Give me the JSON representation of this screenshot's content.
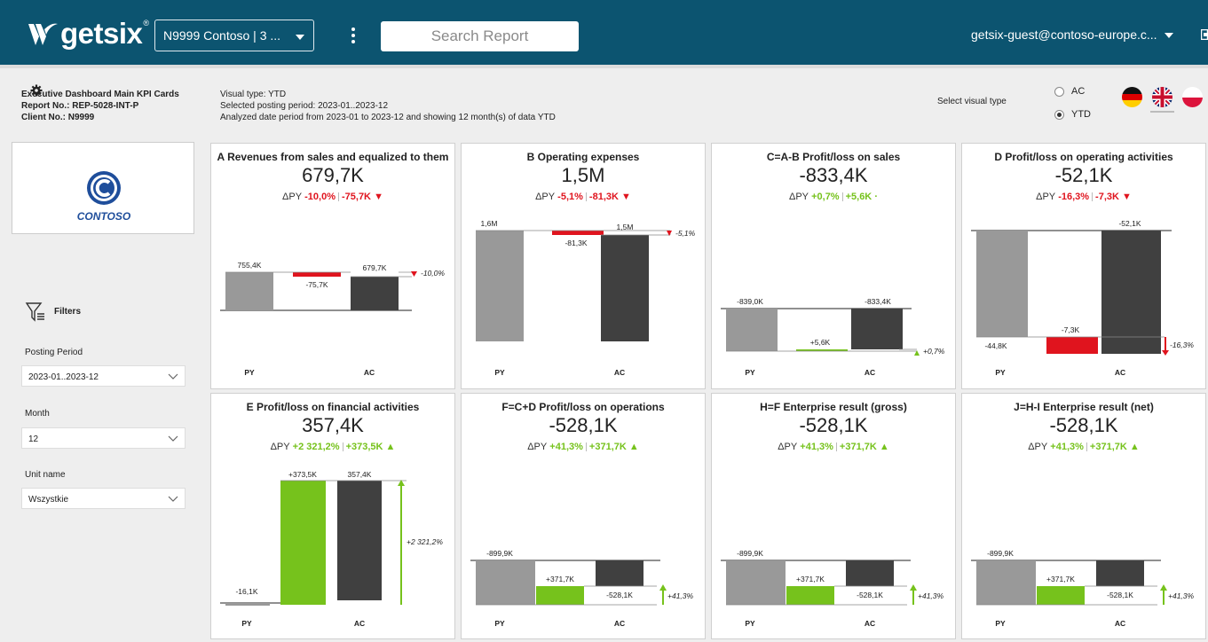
{
  "header": {
    "logo_text": "getsix",
    "logo_mark": "®",
    "client_select": "N9999 Contoso | 3 ...",
    "search_placeholder": "Search Report",
    "user": "getsix-guest@contoso-europe.c..."
  },
  "report": {
    "title": "Executive Dashboard Main KPI Cards",
    "report_no": "Report No.: REP-5028-INT-P",
    "client_no": "Client No.: N9999",
    "visual_type": "Visual type: YTD",
    "posting_period": "Selected posting period: 2023-01..2023-12",
    "analyzed": "Analyzed date period from 2023-01 to 2023-12 and showing 12 month(s) of data YTD"
  },
  "visual_select": {
    "label": "Select visual type",
    "options": [
      {
        "label": "AC",
        "selected": false
      },
      {
        "label": "YTD",
        "selected": true
      }
    ]
  },
  "languages": [
    "de-flag-icon",
    "uk-flag-icon",
    "pl-flag-icon"
  ],
  "sidebar": {
    "logo_text": "CONTOSO",
    "filters_label": "Filters",
    "filters": [
      {
        "label": "Posting Period",
        "value": "2023-01..2023-12"
      },
      {
        "label": "Month",
        "value": "12"
      },
      {
        "label": "Unit name",
        "value": "Wszystkie"
      }
    ]
  },
  "colors": {
    "pos": "#76c21c",
    "neg": "#e0141e",
    "py": "#999999",
    "ac": "#404040",
    "brand": "#0c5470"
  },
  "cards": [
    {
      "title": "A Revenues from sales and equalized to them",
      "value": "679,7K",
      "delta_label": "ΔPY",
      "delta_pct": "-10,0%",
      "delta_abs": "-75,7K",
      "delta_marker": "▼",
      "sign": "neg",
      "bars": {
        "py": 755.4,
        "ac": 679.7,
        "diff": -75.7
      },
      "labels": {
        "py": "755,4K",
        "diff": "-75,7K",
        "ac": "679,7K",
        "pct": "-10,0%"
      },
      "cat_py": "PY",
      "cat_ac": "AC"
    },
    {
      "title": "B Operating expenses",
      "value": "1,5M",
      "delta_label": "ΔPY",
      "delta_pct": "-5,1%",
      "delta_abs": "-81,3K",
      "delta_marker": "▼",
      "sign": "neg",
      "bars": {
        "py": 1600,
        "ac": 1500,
        "diff": -81.3
      },
      "labels": {
        "py": "1,6M",
        "diff": "-81,3K",
        "ac": "1,5M",
        "pct": "-5,1%"
      },
      "cat_py": "PY",
      "cat_ac": "AC"
    },
    {
      "title": "C=A-B Profit/loss on sales",
      "value": "-833,4K",
      "delta_label": "ΔPY",
      "delta_pct": "+0,7%",
      "delta_abs": "+5,6K",
      "delta_marker": "·",
      "sign": "pos",
      "bars": {
        "py": -839.0,
        "ac": -833.4,
        "diff": 5.6
      },
      "labels": {
        "py": "-839,0K",
        "diff": "+5,6K",
        "ac": "-833,4K",
        "pct": "+0,7%"
      },
      "cat_py": "PY",
      "cat_ac": "AC"
    },
    {
      "title": "D Profit/loss on operating activities",
      "value": "-52,1K",
      "delta_label": "ΔPY",
      "delta_pct": "-16,3%",
      "delta_abs": "-7,3K",
      "delta_marker": "▼",
      "sign": "neg",
      "bars": {
        "py": -44.8,
        "ac": -52.1,
        "diff": -7.3
      },
      "labels": {
        "py": "-44,8K",
        "diff": "-7,3K",
        "ac": "-52,1K",
        "pct": "-16,3%"
      },
      "cat_py": "PY",
      "cat_ac": "AC"
    },
    {
      "title": "E Profit/loss on financial activities",
      "value": "357,4K",
      "delta_label": "ΔPY",
      "delta_pct": "+2 321,2%",
      "delta_abs": "+373,5K",
      "delta_marker": "▲",
      "sign": "pos",
      "bars": {
        "py": -16.1,
        "ac": 357.4,
        "diff": 373.5
      },
      "labels": {
        "py": "-16,1K",
        "diff": "+373,5K",
        "ac": "357,4K",
        "pct": "+2 321,2%"
      },
      "cat_py": "PY",
      "cat_ac": "AC"
    },
    {
      "title": "F=C+D Profit/loss on operations",
      "value": "-528,1K",
      "delta_label": "ΔPY",
      "delta_pct": "+41,3%",
      "delta_abs": "+371,7K",
      "delta_marker": "▲",
      "sign": "pos",
      "bars": {
        "py": -899.9,
        "ac": -528.1,
        "diff": 371.7
      },
      "labels": {
        "py": "-899,9K",
        "diff": "+371,7K",
        "ac": "-528,1K",
        "pct": "+41,3%"
      },
      "cat_py": "PY",
      "cat_ac": "AC"
    },
    {
      "title": "H=F Enterprise result (gross)",
      "value": "-528,1K",
      "delta_label": "ΔPY",
      "delta_pct": "+41,3%",
      "delta_abs": "+371,7K",
      "delta_marker": "▲",
      "sign": "pos",
      "bars": {
        "py": -899.9,
        "ac": -528.1,
        "diff": 371.7
      },
      "labels": {
        "py": "-899,9K",
        "diff": "+371,7K",
        "ac": "-528,1K",
        "pct": "+41,3%"
      },
      "cat_py": "PY",
      "cat_ac": "AC"
    },
    {
      "title": "J=H-I Enterprise result (net)",
      "value": "-528,1K",
      "delta_label": "ΔPY",
      "delta_pct": "+41,3%",
      "delta_abs": "+371,7K",
      "delta_marker": "▲",
      "sign": "pos",
      "bars": {
        "py": -899.9,
        "ac": -528.1,
        "diff": 371.7
      },
      "labels": {
        "py": "-899,9K",
        "diff": "+371,7K",
        "ac": "-528,1K",
        "pct": "+41,3%"
      },
      "cat_py": "PY",
      "cat_ac": "AC"
    }
  ]
}
